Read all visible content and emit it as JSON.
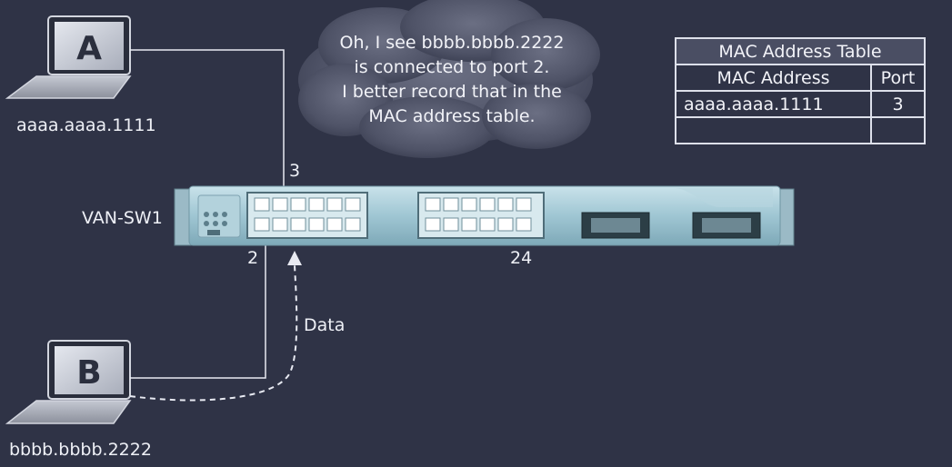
{
  "hosts": [
    {
      "letter": "A",
      "mac": "aaaa.aaaa.1111"
    },
    {
      "letter": "B",
      "mac": "bbbb.bbbb.2222"
    }
  ],
  "switch": {
    "name": "VAN-SW1",
    "port_labels": [
      "3",
      "2",
      "24"
    ]
  },
  "data_label": "Data",
  "thought": {
    "lines": [
      "Oh, I see bbbb.bbbb.2222",
      "is connected to port 2.",
      "I better record that in the",
      "MAC address table."
    ]
  },
  "mac_table": {
    "title": "MAC Address Table",
    "headers": [
      "MAC Address",
      "Port"
    ],
    "rows": [
      [
        "aaaa.aaaa.1111",
        "3"
      ],
      [
        "",
        ""
      ]
    ]
  },
  "colors": {
    "background": "#2f3346",
    "cloud": "#5b5f73",
    "switch_body": "#9fc6d3",
    "link": "#e8eaf2"
  }
}
